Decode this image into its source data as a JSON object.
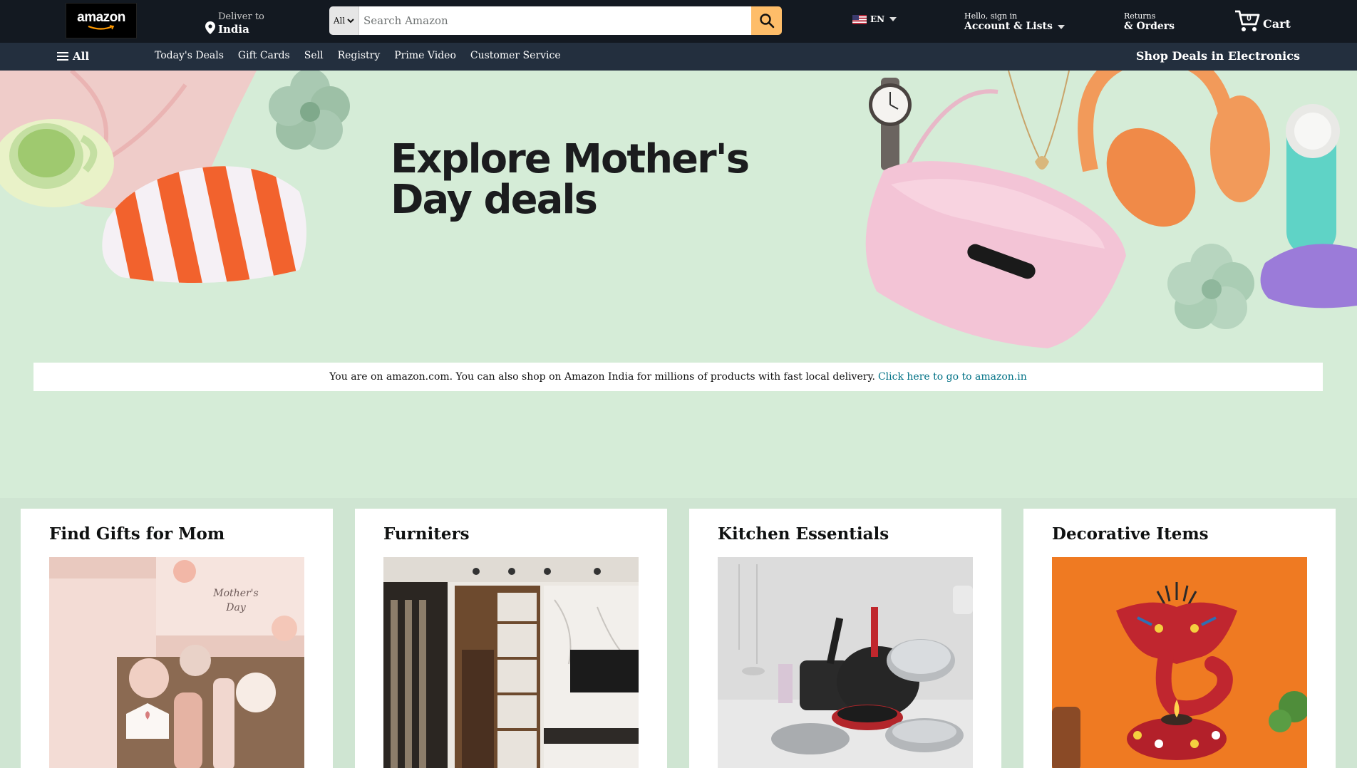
{
  "header": {
    "logo_text": "amazon",
    "deliver_to": "Deliver to",
    "location": "India",
    "search_category": "All",
    "search_placeholder": "Search Amazon",
    "language": "EN",
    "account_greeting": "Hello, sign in",
    "account_label": "Account & Lists",
    "returns_label": "Returns",
    "orders_label": "& Orders",
    "cart_label": "Cart",
    "cart_count": "0"
  },
  "subnav": {
    "all_label": "All",
    "links": [
      "Today's Deals",
      "Gift Cards",
      "Sell",
      "Registry",
      "Prime Video",
      "Customer Service"
    ],
    "promo": "Shop Deals in Electronics"
  },
  "hero": {
    "title_line1": "Explore Mother's",
    "title_line2": "Day deals"
  },
  "notice": {
    "text": "You are on amazon.com. You can also shop on Amazon India for millions of products with fast local delivery.",
    "link": "Click here to go to amazon.in"
  },
  "cards": [
    {
      "title": "Find Gifts for Mom",
      "image": "mothers-day-gift-box"
    },
    {
      "title": "Furniters",
      "image": "living-room-furniture"
    },
    {
      "title": "Kitchen Essentials",
      "image": "cookware-set"
    },
    {
      "title": "Decorative Items",
      "image": "elephant-diya-decor"
    }
  ],
  "colors": {
    "nav_dark": "#131921",
    "nav_sub": "#232f3e",
    "search_button": "#febd69",
    "hero_bg": "#d5ecd7",
    "link": "#007185"
  },
  "icons": [
    "location-pin-icon",
    "chevron-down-icon",
    "search-icon",
    "us-flag-icon",
    "cart-icon",
    "hamburger-menu-icon"
  ]
}
